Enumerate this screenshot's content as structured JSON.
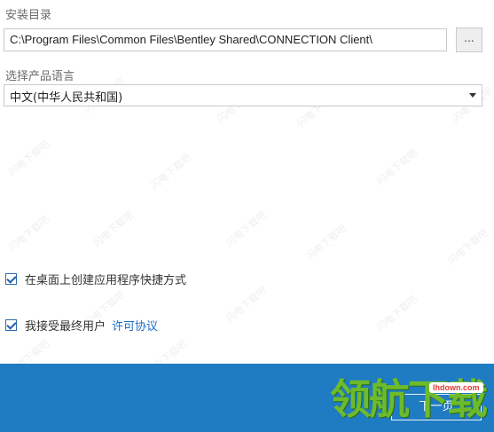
{
  "install_dir": {
    "label": "安装目录",
    "path": "C:\\Program Files\\Common Files\\Bentley Shared\\CONNECTION Client\\",
    "browse_label": "..."
  },
  "language": {
    "label": "选择产品语言",
    "selected": "中文(中华人民共和国)"
  },
  "options": {
    "desktop_shortcut": "在桌面上创建应用程序快捷方式",
    "desktop_shortcut_checked": true,
    "accept_eula": "我接受最终用户",
    "accept_eula_checked": true,
    "eula_link": "许可协议"
  },
  "footer": {
    "next_label": "下一页"
  },
  "watermark": {
    "text": "闪电下载吧",
    "logo_text": "领航下载",
    "logo_site": "lhdown.com"
  },
  "colors": {
    "footer_bg": "#1f7bc2",
    "link": "#1e6fc4",
    "logo": "#6dbb2d"
  }
}
